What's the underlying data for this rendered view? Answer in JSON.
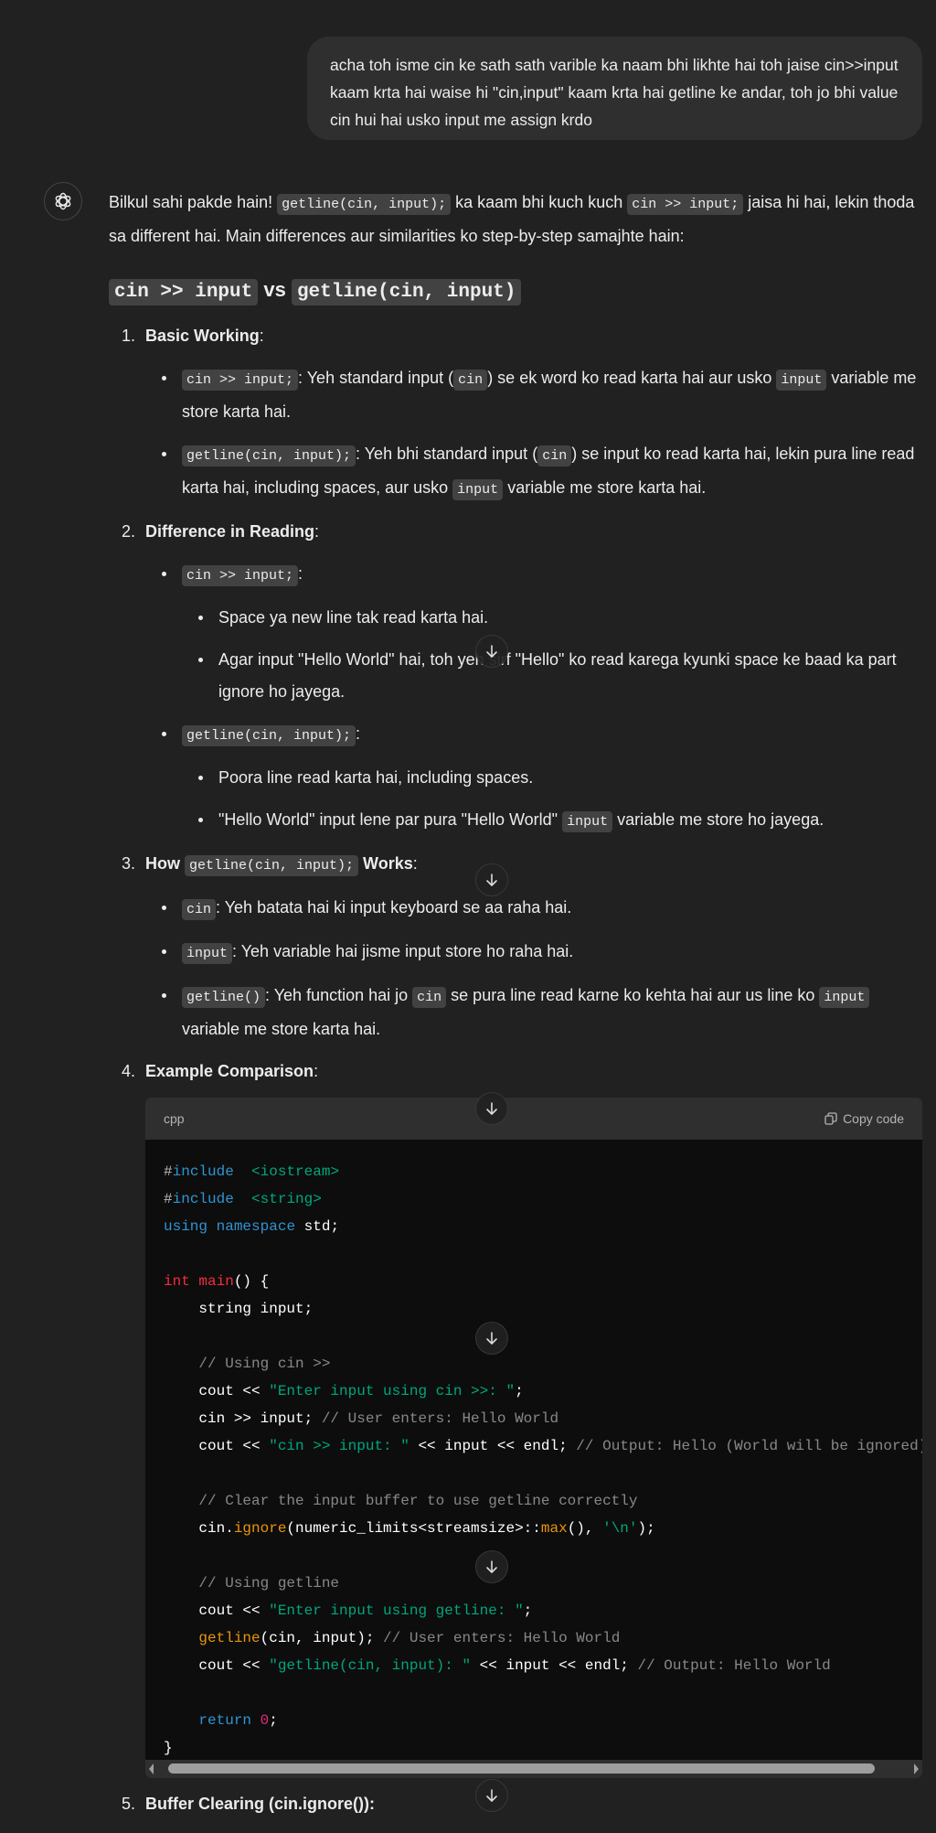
{
  "user_message": "acha toh isme cin ke sath sath varible ka naam bhi likhte hai toh jaise cin>>input kaam krta hai waise hi \"cin,input\" kaam krta hai getline ke andar, toh jo bhi value cin hui hai usko input me assign krdo",
  "intro": [
    {
      "t": "Bilkul sahi pakde hain! "
    },
    {
      "t": "getline(cin, input);",
      "code": true
    },
    {
      "t": " ka kaam bhi kuch kuch "
    },
    {
      "t": "cin >> input;",
      "code": true
    },
    {
      "t": " jaisa hi hai, lekin thoda sa different hai. Main differences aur similarities ko step-by-step samajhte hain:"
    }
  ],
  "heading": [
    {
      "t": "cin >> input",
      "code": true
    },
    {
      "t": " vs "
    },
    {
      "t": "getline(cin, input)",
      "code": true
    }
  ],
  "sections": [
    {
      "num": "1.",
      "title": [
        {
          "t": "Basic Working",
          "b": true
        },
        {
          "t": ":"
        }
      ],
      "bullets": [
        {
          "text": [
            {
              "t": "cin >> input;",
              "code": true
            },
            {
              "t": ": Yeh standard input ("
            },
            {
              "t": "cin",
              "code": true
            },
            {
              "t": ") se ek word ko read karta hai aur usko "
            },
            {
              "t": "input",
              "code": true
            },
            {
              "t": " variable me store karta hai."
            }
          ]
        },
        {
          "text": [
            {
              "t": "getline(cin, input);",
              "code": true
            },
            {
              "t": ": Yeh bhi standard input ("
            },
            {
              "t": "cin",
              "code": true
            },
            {
              "t": ") se input ko read karta hai, lekin pura line read karta hai, including spaces, aur usko "
            },
            {
              "t": "input",
              "code": true
            },
            {
              "t": " variable me store karta hai."
            }
          ]
        }
      ]
    },
    {
      "num": "2.",
      "title": [
        {
          "t": "Difference in Reading",
          "b": true
        },
        {
          "t": ":"
        }
      ],
      "bullets": [
        {
          "text": [
            {
              "t": "cin >> input;",
              "code": true
            },
            {
              "t": ":"
            }
          ],
          "sub": [
            [
              {
                "t": "Space ya new line tak read karta hai."
              }
            ],
            [
              {
                "t": "Agar input \"Hello World\" hai, toh yeh sirf \"Hello\" ko read karega kyunki space ke baad ka part ignore ho jayega."
              }
            ]
          ]
        },
        {
          "text": [
            {
              "t": "getline(cin, input);",
              "code": true
            },
            {
              "t": ":"
            }
          ],
          "sub": [
            [
              {
                "t": "Poora line read karta hai, including spaces."
              }
            ],
            [
              {
                "t": "\"Hello World\" input lene par pura \"Hello World\" "
              },
              {
                "t": "input",
                "code": true
              },
              {
                "t": " variable me store ho jayega."
              }
            ]
          ]
        }
      ]
    },
    {
      "num": "3.",
      "title": [
        {
          "t": "How ",
          "b": true
        },
        {
          "t": "getline(cin, input);",
          "code": true
        },
        {
          "t": " Works",
          "b": true
        },
        {
          "t": ":"
        }
      ],
      "bullets": [
        {
          "text": [
            {
              "t": "cin",
              "code": true
            },
            {
              "t": ": Yeh batata hai ki input keyboard se aa raha hai."
            }
          ]
        },
        {
          "text": [
            {
              "t": "input",
              "code": true
            },
            {
              "t": ": Yeh variable hai jisme input store ho raha hai."
            }
          ]
        },
        {
          "text": [
            {
              "t": "getline()",
              "code": true
            },
            {
              "t": ": Yeh function hai jo "
            },
            {
              "t": "cin",
              "code": true
            },
            {
              "t": " se pura line read karne ko kehta hai aur us line ko "
            },
            {
              "t": "input",
              "code": true
            },
            {
              "t": " variable me store karta hai."
            }
          ]
        }
      ]
    },
    {
      "num": "4.",
      "title": [
        {
          "t": "Example Comparison",
          "b": true
        },
        {
          "t": ":"
        }
      ],
      "bullets": [],
      "has_code": true
    },
    {
      "num": "5.",
      "title": [
        {
          "t": "Buffer Clearing (cin.ignore()):",
          "b": true
        }
      ],
      "bullets": []
    }
  ],
  "code": {
    "language": "cpp",
    "copy_label": "Copy code",
    "lines": [
      [
        [
          "pre",
          "#"
        ],
        [
          "kw",
          "include"
        ],
        [
          "",
          "  "
        ],
        [
          "str",
          "<iostream>"
        ]
      ],
      [
        [
          "pre",
          "#"
        ],
        [
          "kw",
          "include"
        ],
        [
          "",
          "  "
        ],
        [
          "str",
          "<string>"
        ]
      ],
      [
        [
          "kw",
          "using"
        ],
        [
          "",
          " "
        ],
        [
          "kw",
          "namespace"
        ],
        [
          "",
          " std;"
        ]
      ],
      [],
      [
        [
          "red",
          "int"
        ],
        [
          "",
          " "
        ],
        [
          "red",
          "main"
        ],
        [
          "",
          "() {"
        ]
      ],
      [
        [
          "",
          "    string input;"
        ]
      ],
      [],
      [
        [
          "",
          "    "
        ],
        [
          "com",
          "// Using cin >>"
        ]
      ],
      [
        [
          "",
          "    cout << "
        ],
        [
          "str",
          "\"Enter input using cin >>: \""
        ],
        [
          "",
          ";"
        ]
      ],
      [
        [
          "",
          "    cin >> input; "
        ],
        [
          "com",
          "// User enters: Hello World"
        ]
      ],
      [
        [
          "",
          "    cout << "
        ],
        [
          "str",
          "\"cin >> input: \""
        ],
        [
          "",
          " << input << endl; "
        ],
        [
          "com",
          "// Output: Hello (World will be ignored)"
        ]
      ],
      [],
      [
        [
          "",
          "    "
        ],
        [
          "com",
          "// Clear the input buffer to use getline correctly"
        ]
      ],
      [
        [
          "",
          "    cin."
        ],
        [
          "fn",
          "ignore"
        ],
        [
          "",
          "(numeric_limits<streamsize>::"
        ],
        [
          "fn",
          "max"
        ],
        [
          "",
          "(), "
        ],
        [
          "str",
          "'\\n'"
        ],
        [
          "",
          ");"
        ]
      ],
      [],
      [
        [
          "",
          "    "
        ],
        [
          "com",
          "// Using getline"
        ]
      ],
      [
        [
          "",
          "    cout << "
        ],
        [
          "str",
          "\"Enter input using getline: \""
        ],
        [
          "",
          ";"
        ]
      ],
      [
        [
          "",
          "    "
        ],
        [
          "fn",
          "getline"
        ],
        [
          "",
          "(cin, input); "
        ],
        [
          "com",
          "// User enters: Hello World"
        ]
      ],
      [
        [
          "",
          "    cout << "
        ],
        [
          "str",
          "\"getline(cin, input): \""
        ],
        [
          "",
          " << input << endl; "
        ],
        [
          "com",
          "// Output: Hello World"
        ]
      ],
      [],
      [
        [
          "",
          "    "
        ],
        [
          "kw",
          "return"
        ],
        [
          "",
          " "
        ],
        [
          "num",
          "0"
        ],
        [
          "",
          ";"
        ]
      ],
      [
        [
          "",
          "}"
        ]
      ]
    ]
  }
}
